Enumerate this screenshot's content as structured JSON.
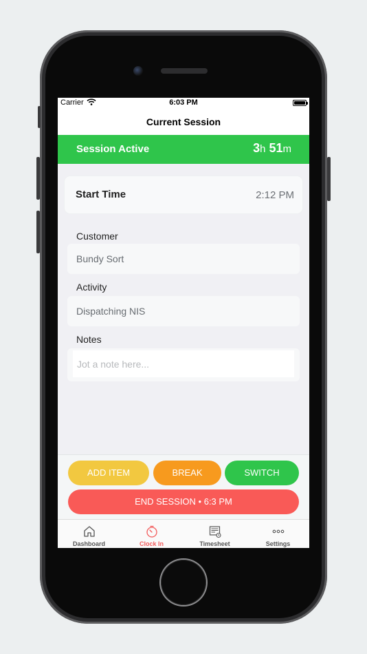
{
  "status_bar": {
    "carrier": "Carrier",
    "time": "6:03 PM"
  },
  "nav": {
    "title": "Current Session"
  },
  "session": {
    "status_label": "Session Active",
    "hours": "3",
    "hours_unit": "h",
    "minutes": "51",
    "minutes_unit": "m",
    "status_color": "#2fc54b"
  },
  "start_time": {
    "label": "Start Time",
    "value": "2:12 PM"
  },
  "customer": {
    "label": "Customer",
    "value": "Bundy Sort"
  },
  "activity": {
    "label": "Activity",
    "value": "Dispatching NIS"
  },
  "notes": {
    "label": "Notes",
    "placeholder": "Jot a note here..."
  },
  "actions": {
    "add_item": "ADD ITEM",
    "break": "BREAK",
    "switch": "SWITCH",
    "end_session": "END SESSION • 6:3 PM",
    "colors": {
      "add_item": "#f2c840",
      "break": "#f79a1e",
      "switch": "#2fc54b",
      "end_session": "#f95a57"
    }
  },
  "tabs": [
    {
      "label": "Dashboard",
      "icon": "house-icon",
      "active": false
    },
    {
      "label": "Clock In",
      "icon": "stopwatch-icon",
      "active": true
    },
    {
      "label": "Timesheet",
      "icon": "timesheet-icon",
      "active": false
    },
    {
      "label": "Settings",
      "icon": "ellipsis-icon",
      "active": false
    }
  ]
}
